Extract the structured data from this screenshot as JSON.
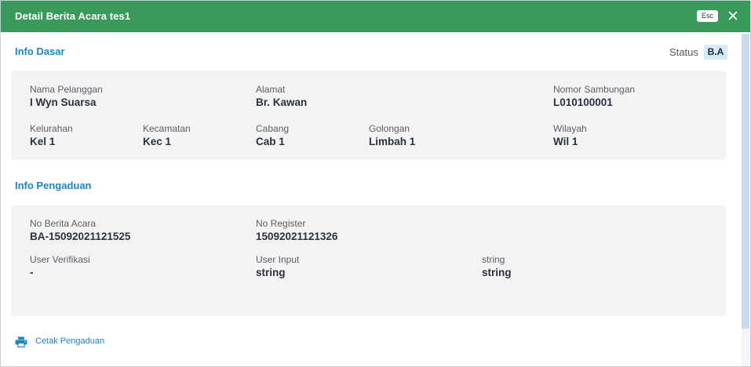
{
  "dialog": {
    "title": "Detail Berita Acara tes1",
    "esc_label": "Esc",
    "close_icon": "close-icon"
  },
  "info_dasar": {
    "title": "Info Dasar",
    "status_label": "Status",
    "status_value": "B.A",
    "fields": {
      "nama_pelanggan": {
        "label": "Nama Pelanggan",
        "value": "I Wyn Suarsa"
      },
      "alamat": {
        "label": "Alamat",
        "value": "Br. Kawan"
      },
      "nomor_sambungan": {
        "label": "Nomor Sambungan",
        "value": "L010100001"
      },
      "kelurahan": {
        "label": "Kelurahan",
        "value": "Kel 1"
      },
      "kecamatan": {
        "label": "Kecamatan",
        "value": "Kec 1"
      },
      "cabang": {
        "label": "Cabang",
        "value": "Cab 1"
      },
      "golongan": {
        "label": "Golongan",
        "value": "Limbah 1"
      },
      "wilayah": {
        "label": "Wilayah",
        "value": "Wil 1"
      }
    }
  },
  "info_pengaduan": {
    "title": "Info Pengaduan",
    "fields": {
      "no_berita_acara": {
        "label": "No Berita Acara",
        "value": "BA-15092021121525"
      },
      "no_register": {
        "label": "No Register",
        "value": "15092021121326"
      },
      "user_verifikasi": {
        "label": "User Verifikasi",
        "value": "-"
      },
      "user_input": {
        "label": "User Input",
        "value": "string"
      },
      "string_field": {
        "label": "string",
        "value": "string"
      }
    }
  },
  "actions": {
    "print_label": "Cetak Pengaduan",
    "print_icon": "printer-icon"
  },
  "colors": {
    "header": "#3a9a5b",
    "accent": "#1a86c5",
    "panel": "#f3f3f3",
    "status_badge": "#d6ebfa"
  }
}
